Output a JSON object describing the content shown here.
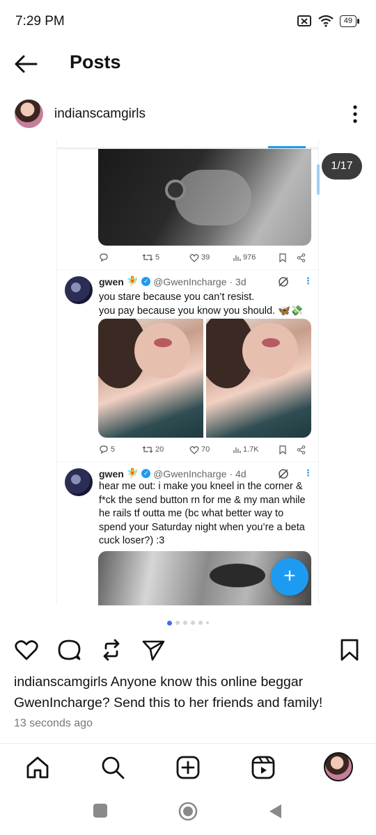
{
  "status_bar": {
    "time": "7:29 PM",
    "battery": "49"
  },
  "header": {
    "title": "Posts"
  },
  "profile": {
    "username": "indianscamgirls"
  },
  "media": {
    "counter": "1/17",
    "tweets": [
      {
        "reply": "",
        "retweets": "5",
        "likes": "39",
        "views": "976"
      },
      {
        "name": "gwen",
        "emoji": "🧚",
        "handle": "@GwenIncharge",
        "age": "· 3d",
        "text": "you stare because you can’t resist.\nyou pay because you know you should. 🦋💸",
        "replies": "5",
        "retweets": "20",
        "likes": "70",
        "views": "1.7K"
      },
      {
        "name": "gwen",
        "emoji": "🧚",
        "handle": "@GwenIncharge",
        "age": "· 4d",
        "text": "hear me out: i make you kneel in the corner & f*ck the send button rn for me & my man while he rails tf outta me (bc what better way to spend your Saturday night when you’re a beta cuck loser?) :3"
      }
    ],
    "fab_label": "+"
  },
  "carousel": {
    "count": 6,
    "active": 0
  },
  "caption": {
    "username": "indianscamgirls",
    "text": "Anyone know this online beggar GwenIncharge? Send this to her friends and family!",
    "timestamp": "13 seconds ago"
  },
  "colors": {
    "accent": "#1d9bf0",
    "carousel_active": "#3f6ff0",
    "pill_bg": "#3b3b3b"
  }
}
